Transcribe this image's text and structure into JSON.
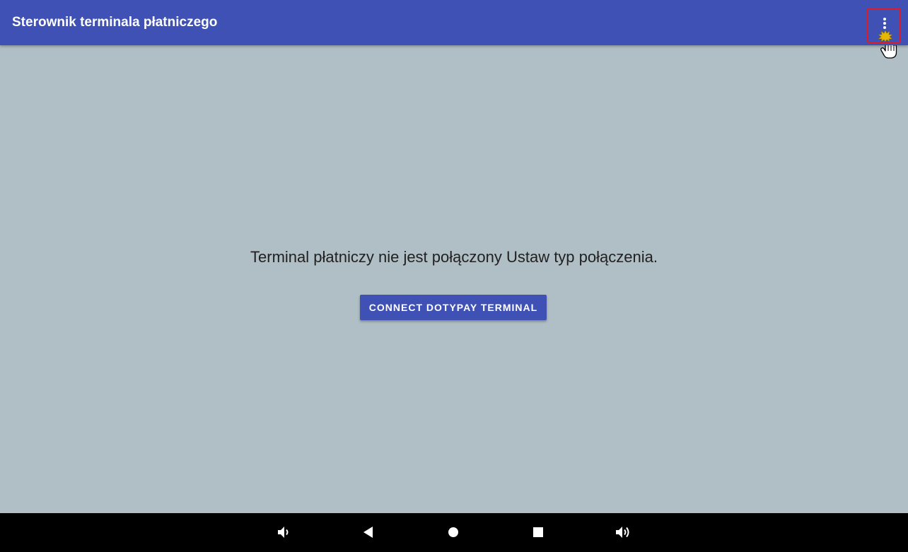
{
  "appbar": {
    "title": "Sterownik terminala płatniczego",
    "color": "#3F51B5",
    "overflow_icon": "more-vert-icon",
    "highlight_color": "#E01B24"
  },
  "main": {
    "background": "#B0BEC5",
    "message": "Terminal płatniczy nie jest połączony Ustaw typ połączenia.",
    "connect_button_label": "CONNECT DOTYPAY TERMINAL"
  },
  "navbar": {
    "icons": [
      "volume-down-icon",
      "back-icon",
      "home-icon",
      "recents-icon",
      "volume-up-icon"
    ]
  },
  "cursor": {
    "icon": "hand-pointer-icon"
  }
}
